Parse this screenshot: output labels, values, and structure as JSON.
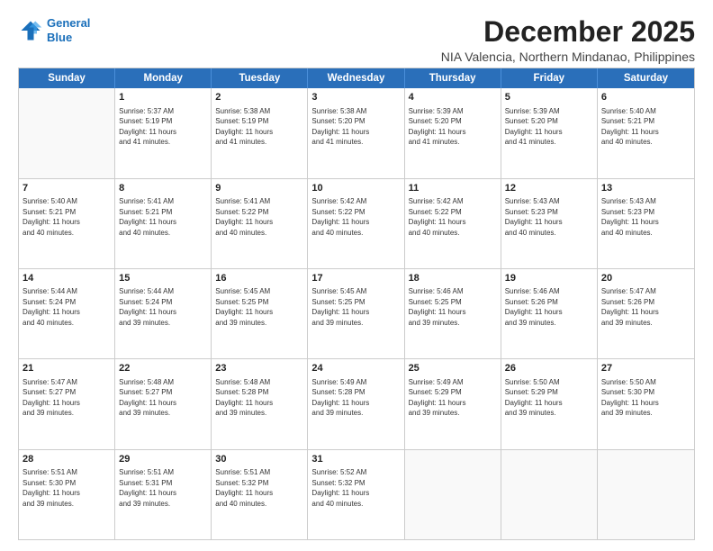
{
  "logo": {
    "line1": "General",
    "line2": "Blue"
  },
  "title": "December 2025",
  "location": "NIA Valencia, Northern Mindanao, Philippines",
  "header": {
    "days": [
      "Sunday",
      "Monday",
      "Tuesday",
      "Wednesday",
      "Thursday",
      "Friday",
      "Saturday"
    ]
  },
  "weeks": [
    [
      {
        "day": "",
        "info": ""
      },
      {
        "day": "1",
        "info": "Sunrise: 5:37 AM\nSunset: 5:19 PM\nDaylight: 11 hours\nand 41 minutes."
      },
      {
        "day": "2",
        "info": "Sunrise: 5:38 AM\nSunset: 5:19 PM\nDaylight: 11 hours\nand 41 minutes."
      },
      {
        "day": "3",
        "info": "Sunrise: 5:38 AM\nSunset: 5:20 PM\nDaylight: 11 hours\nand 41 minutes."
      },
      {
        "day": "4",
        "info": "Sunrise: 5:39 AM\nSunset: 5:20 PM\nDaylight: 11 hours\nand 41 minutes."
      },
      {
        "day": "5",
        "info": "Sunrise: 5:39 AM\nSunset: 5:20 PM\nDaylight: 11 hours\nand 41 minutes."
      },
      {
        "day": "6",
        "info": "Sunrise: 5:40 AM\nSunset: 5:21 PM\nDaylight: 11 hours\nand 40 minutes."
      }
    ],
    [
      {
        "day": "7",
        "info": "Sunrise: 5:40 AM\nSunset: 5:21 PM\nDaylight: 11 hours\nand 40 minutes."
      },
      {
        "day": "8",
        "info": "Sunrise: 5:41 AM\nSunset: 5:21 PM\nDaylight: 11 hours\nand 40 minutes."
      },
      {
        "day": "9",
        "info": "Sunrise: 5:41 AM\nSunset: 5:22 PM\nDaylight: 11 hours\nand 40 minutes."
      },
      {
        "day": "10",
        "info": "Sunrise: 5:42 AM\nSunset: 5:22 PM\nDaylight: 11 hours\nand 40 minutes."
      },
      {
        "day": "11",
        "info": "Sunrise: 5:42 AM\nSunset: 5:22 PM\nDaylight: 11 hours\nand 40 minutes."
      },
      {
        "day": "12",
        "info": "Sunrise: 5:43 AM\nSunset: 5:23 PM\nDaylight: 11 hours\nand 40 minutes."
      },
      {
        "day": "13",
        "info": "Sunrise: 5:43 AM\nSunset: 5:23 PM\nDaylight: 11 hours\nand 40 minutes."
      }
    ],
    [
      {
        "day": "14",
        "info": "Sunrise: 5:44 AM\nSunset: 5:24 PM\nDaylight: 11 hours\nand 40 minutes."
      },
      {
        "day": "15",
        "info": "Sunrise: 5:44 AM\nSunset: 5:24 PM\nDaylight: 11 hours\nand 39 minutes."
      },
      {
        "day": "16",
        "info": "Sunrise: 5:45 AM\nSunset: 5:25 PM\nDaylight: 11 hours\nand 39 minutes."
      },
      {
        "day": "17",
        "info": "Sunrise: 5:45 AM\nSunset: 5:25 PM\nDaylight: 11 hours\nand 39 minutes."
      },
      {
        "day": "18",
        "info": "Sunrise: 5:46 AM\nSunset: 5:25 PM\nDaylight: 11 hours\nand 39 minutes."
      },
      {
        "day": "19",
        "info": "Sunrise: 5:46 AM\nSunset: 5:26 PM\nDaylight: 11 hours\nand 39 minutes."
      },
      {
        "day": "20",
        "info": "Sunrise: 5:47 AM\nSunset: 5:26 PM\nDaylight: 11 hours\nand 39 minutes."
      }
    ],
    [
      {
        "day": "21",
        "info": "Sunrise: 5:47 AM\nSunset: 5:27 PM\nDaylight: 11 hours\nand 39 minutes."
      },
      {
        "day": "22",
        "info": "Sunrise: 5:48 AM\nSunset: 5:27 PM\nDaylight: 11 hours\nand 39 minutes."
      },
      {
        "day": "23",
        "info": "Sunrise: 5:48 AM\nSunset: 5:28 PM\nDaylight: 11 hours\nand 39 minutes."
      },
      {
        "day": "24",
        "info": "Sunrise: 5:49 AM\nSunset: 5:28 PM\nDaylight: 11 hours\nand 39 minutes."
      },
      {
        "day": "25",
        "info": "Sunrise: 5:49 AM\nSunset: 5:29 PM\nDaylight: 11 hours\nand 39 minutes."
      },
      {
        "day": "26",
        "info": "Sunrise: 5:50 AM\nSunset: 5:29 PM\nDaylight: 11 hours\nand 39 minutes."
      },
      {
        "day": "27",
        "info": "Sunrise: 5:50 AM\nSunset: 5:30 PM\nDaylight: 11 hours\nand 39 minutes."
      }
    ],
    [
      {
        "day": "28",
        "info": "Sunrise: 5:51 AM\nSunset: 5:30 PM\nDaylight: 11 hours\nand 39 minutes."
      },
      {
        "day": "29",
        "info": "Sunrise: 5:51 AM\nSunset: 5:31 PM\nDaylight: 11 hours\nand 39 minutes."
      },
      {
        "day": "30",
        "info": "Sunrise: 5:51 AM\nSunset: 5:32 PM\nDaylight: 11 hours\nand 40 minutes."
      },
      {
        "day": "31",
        "info": "Sunrise: 5:52 AM\nSunset: 5:32 PM\nDaylight: 11 hours\nand 40 minutes."
      },
      {
        "day": "",
        "info": ""
      },
      {
        "day": "",
        "info": ""
      },
      {
        "day": "",
        "info": ""
      }
    ]
  ]
}
